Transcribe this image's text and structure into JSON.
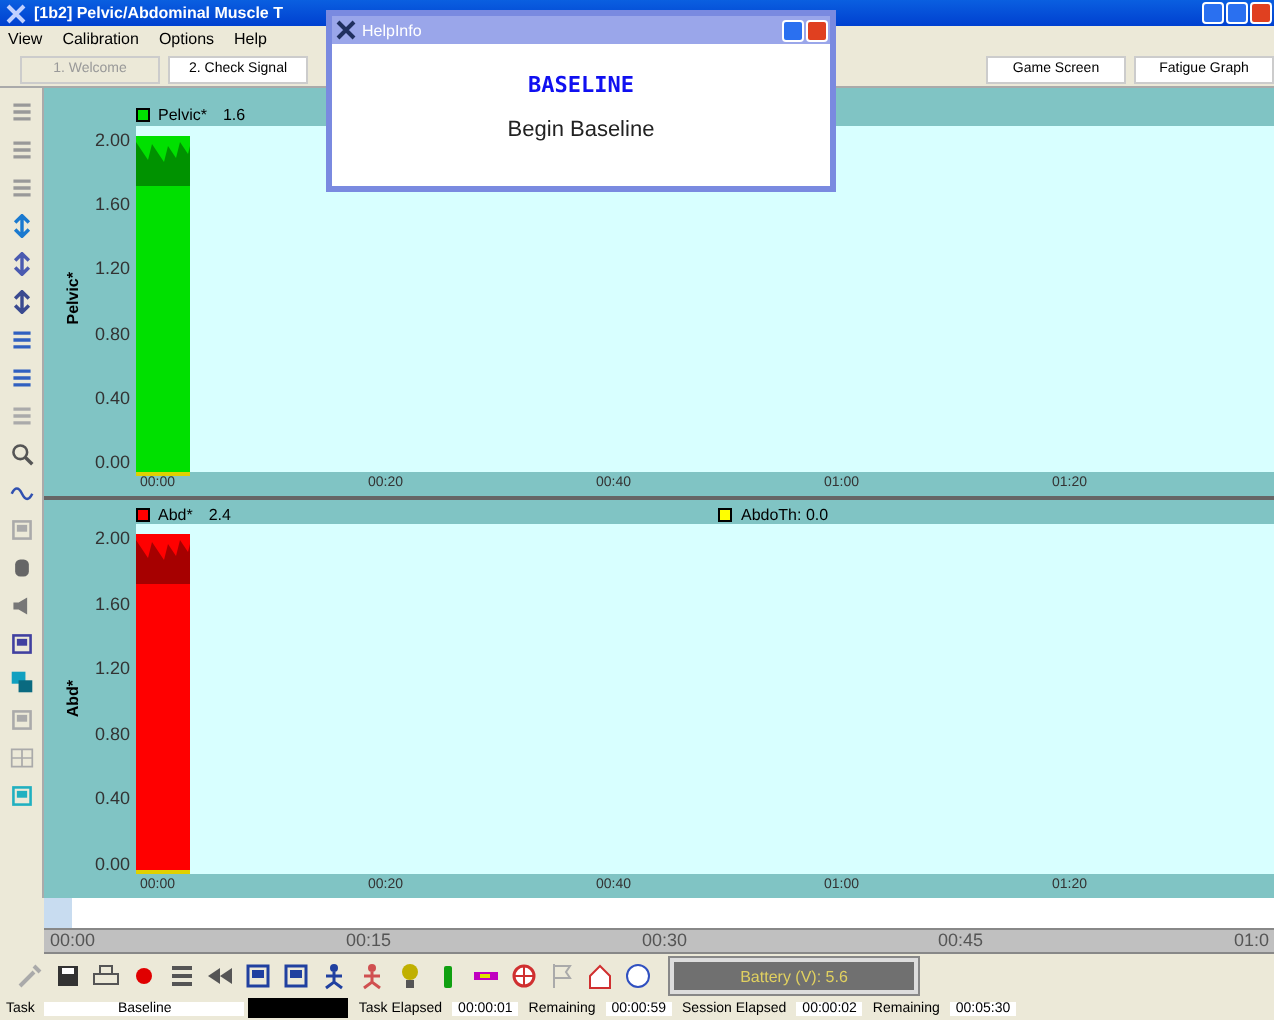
{
  "window": {
    "title": "[1b2] Pelvic/Abdominal Muscle T"
  },
  "menu": [
    "View",
    "Calibration",
    "Options",
    "Help"
  ],
  "steps": [
    {
      "label": "1. Welcome",
      "disabled": true
    },
    {
      "label": "2. Check Signal",
      "disabled": false
    },
    {
      "label": "Game Screen",
      "disabled": false
    },
    {
      "label": "Fatigue Graph",
      "disabled": false
    }
  ],
  "popup": {
    "title": "HelpInfo",
    "heading": "BASELINE",
    "text": "Begin Baseline"
  },
  "graphs": [
    {
      "channel": "Pelvic*",
      "reading": "1.6",
      "ylabel": "Pelvic*",
      "color": "#00e000",
      "yticks": [
        "2.00",
        "1.60",
        "1.20",
        "0.80",
        "0.40",
        "0.00"
      ],
      "xticks": [
        "00:00",
        "00:20",
        "00:40",
        "01:00",
        "01:20"
      ]
    },
    {
      "channel": "Abd*",
      "reading": "2.4",
      "ylabel": "Abd*",
      "color": "#ff0000",
      "threshold": {
        "label": "AbdoTh: 0.0",
        "color": "#ffff00"
      },
      "yticks": [
        "2.00",
        "1.60",
        "1.20",
        "0.80",
        "0.40",
        "0.00"
      ],
      "xticks": [
        "00:00",
        "00:20",
        "00:40",
        "01:00",
        "01:20"
      ]
    }
  ],
  "timeline": {
    "ticks": [
      "00:00",
      "00:15",
      "00:30",
      "00:45",
      "01:0"
    ]
  },
  "battery": "Battery (V): 5.6",
  "status": {
    "task_label": "Task",
    "task": "Baseline",
    "fields": [
      {
        "label": "Task Elapsed",
        "value": "00:00:01"
      },
      {
        "label": "Remaining",
        "value": "00:00:59"
      },
      {
        "label": "Session Elapsed",
        "value": "00:00:02"
      },
      {
        "label": "Remaining",
        "value": "00:05:30"
      }
    ]
  }
}
